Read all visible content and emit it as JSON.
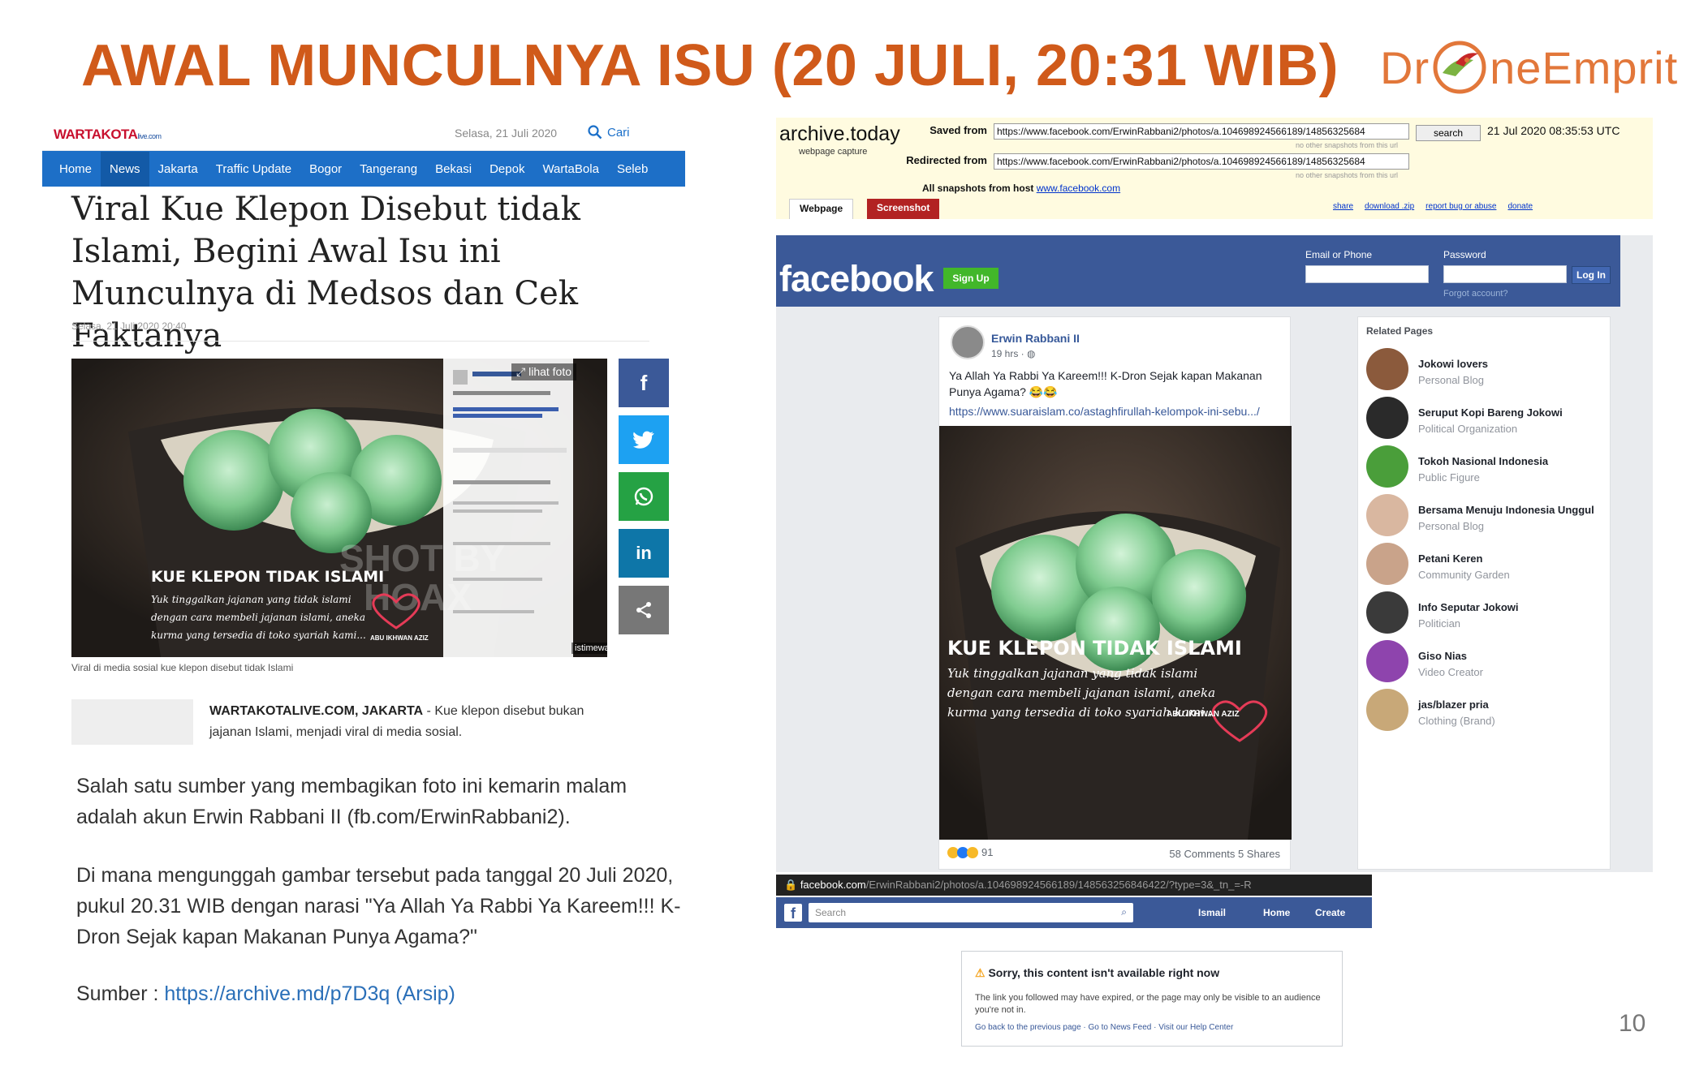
{
  "slide": {
    "title": "AWAL MUNCULNYA ISU (20 JULI, 20:31 WIB)",
    "logo_left": "Dr",
    "logo_right": "neEmprit",
    "page_number": "10"
  },
  "wartakota": {
    "brand": "WARTAKOTA",
    "brand_suffix": "live.com",
    "date": "Selasa, 21 Juli 2020",
    "search_label": "Cari",
    "nav": [
      "Home",
      "News",
      "Jakarta",
      "Traffic Update",
      "Bogor",
      "Tangerang",
      "Bekasi",
      "Depok",
      "WartaBola",
      "Seleb"
    ],
    "headline": "Viral Kue Klepon Disebut tidak Islami, Begini Awal Isu ini Munculnya di Medsos dan Cek Faktanya",
    "pub_date": "Selasa, 21 Juli 2020 20:40",
    "photo_link": "lihat foto",
    "photo_credit": "istimewa",
    "caption": "Viral di media sosial kue klepon disebut tidak Islami",
    "lead_bold": "WARTAKOTALIVE.COM, JAKARTA",
    "lead_text": " - Kue klepon disebut bukan jajanan Islami, menjadi viral di media sosial."
  },
  "klepon": {
    "title": "KUE KLEPON TIDAK ISLAMI",
    "line1": "Yuk tinggalkan jajanan yang tidak islami",
    "line2": "dengan cara membeli jajanan islami, aneka",
    "line3": "kurma yang tersedia di toko syariah kami...",
    "signature": "ABU IKHWAN AZIZ"
  },
  "body": {
    "para1": "Salah satu sumber yang membagikan foto ini kemarin malam adalah akun Erwin Rabbani II (fb.com/ErwinRabbani2).",
    "para2": "Di mana mengunggah gambar tersebut pada tanggal 20 Juli 2020, pukul 20.31 WIB dengan narasi \"Ya Allah Ya Rabbi Ya Kareem!!! K-Dron Sejak kapan Makanan Punya Agama?\"",
    "source_label": "Sumber : ",
    "source_link": "https://archive.md/p7D3q (Arsip)"
  },
  "archive": {
    "logo": "archive.today",
    "sub": "webpage capture",
    "saved_from_label": "Saved from",
    "saved_from_url": "https://www.facebook.com/ErwinRabbani2/photos/a.104698924566189/14856325684",
    "search_button": "search",
    "timestamp": "21 Jul 2020 08:35:53 UTC",
    "no_other": "no other snapshots from this url",
    "redirected_label": "Redirected from",
    "redirected_url": "https://www.facebook.com/ErwinRabbani2/photos/a.104698924566189/14856325684",
    "all_snapshots": "All snapshots",
    "from_host": "from host",
    "host": "www.facebook.com",
    "tab_webpage": "Webpage",
    "tab_screenshot": "Screenshot",
    "links": [
      "share",
      "download .zip",
      "report bug or abuse",
      "donate"
    ]
  },
  "facebook": {
    "logo": "facebook",
    "signup": "Sign Up",
    "email_label": "Email or Phone",
    "password_label": "Password",
    "login": "Log In",
    "forgot": "Forgot account?",
    "author": "Erwin Rabbani II",
    "time": "19 hrs · ",
    "post_text": "Ya Allah Ya Rabbi Ya Kareem!!! K-Dron Sejak kapan Makanan Punya Agama? 😂😂",
    "post_link": "https://www.suaraislam.co/astaghfirullah-kelompok-ini-sebu.../",
    "reactions": "91",
    "stats": "58 Comments  5 Shares",
    "related_title": "Related Pages",
    "related": [
      {
        "name": "Jokowi lovers",
        "category": "Personal Blog"
      },
      {
        "name": "Seruput Kopi Bareng Jokowi",
        "category": "Political Organization"
      },
      {
        "name": "Tokoh Nasional Indonesia",
        "category": "Public Figure"
      },
      {
        "name": "Bersama Menuju Indonesia Unggul",
        "category": "Personal Blog"
      },
      {
        "name": "Petani Keren",
        "category": "Community Garden"
      },
      {
        "name": "Info Seputar Jokowi",
        "category": "Politician"
      },
      {
        "name": "Giso Nias",
        "category": "Video Creator"
      },
      {
        "name": "jas/blazer pria",
        "category": "Clothing (Brand)"
      }
    ],
    "url_bar_host": "facebook.com",
    "url_bar_path": "/ErwinRabbani2/photos/a.104698924566189/148563256846422/?type=3&_tn_=-R",
    "search_placeholder": "Search",
    "bottom_nav": [
      "Ismail",
      "Home",
      "Create"
    ],
    "error_title": "Sorry, this content isn't available right now",
    "error_body": "The link you followed may have expired, or the page may only be visible to an audience you're not in.",
    "error_links": "Go back to the previous page · Go to News Feed · Visit our Help Center"
  },
  "colors": {
    "title": "#d05a1a",
    "wk_nav": "#1d6fc7",
    "fb_blue": "#3b5998",
    "archive_bg": "#fffbe0"
  }
}
